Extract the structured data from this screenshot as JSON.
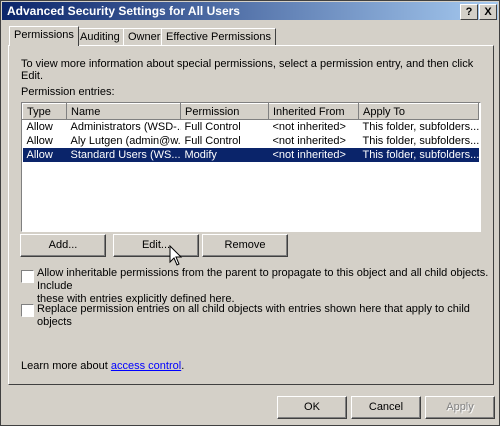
{
  "window": {
    "title": "Advanced Security Settings for All Users",
    "help_glyph": "?",
    "close_glyph": "X"
  },
  "tabs": [
    {
      "label": "Permissions"
    },
    {
      "label": "Auditing"
    },
    {
      "label": "Owner"
    },
    {
      "label": "Effective Permissions"
    }
  ],
  "intro": "To view more information about special permissions, select a permission entry, and then click Edit.",
  "entries_label": "Permission entries:",
  "columns": [
    "Type",
    "Name",
    "Permission",
    "Inherited From",
    "Apply To"
  ],
  "rows": [
    [
      "Allow",
      "Administrators (WSD-...",
      "Full Control",
      "<not inherited>",
      "This folder, subfolders..."
    ],
    [
      "Allow",
      "Aly Lutgen (admin@w...",
      "Full Control",
      "<not inherited>",
      "This folder, subfolders..."
    ],
    [
      "Allow",
      "Standard Users (WS...",
      "Modify",
      "<not inherited>",
      "This folder, subfolders..."
    ]
  ],
  "selected_row": 2,
  "buttons": {
    "add": "Add...",
    "edit": "Edit...",
    "remove": "Remove"
  },
  "checkboxes": {
    "inherit_line1": "Allow inheritable permissions from the parent to propagate to this object and all child objects. Include",
    "inherit_line2": "these with entries explicitly defined here.",
    "replace": "Replace permission entries on all child objects with entries shown here that apply to child objects"
  },
  "learn_more": {
    "prefix": "Learn more about ",
    "link": "access control",
    "suffix": "."
  },
  "footer": {
    "ok": "OK",
    "cancel": "Cancel",
    "apply": "Apply"
  },
  "colors": {
    "title_start": "#0a246a",
    "title_end": "#a6caf0",
    "selection": "#0a246a",
    "face": "#d4d0c8"
  }
}
